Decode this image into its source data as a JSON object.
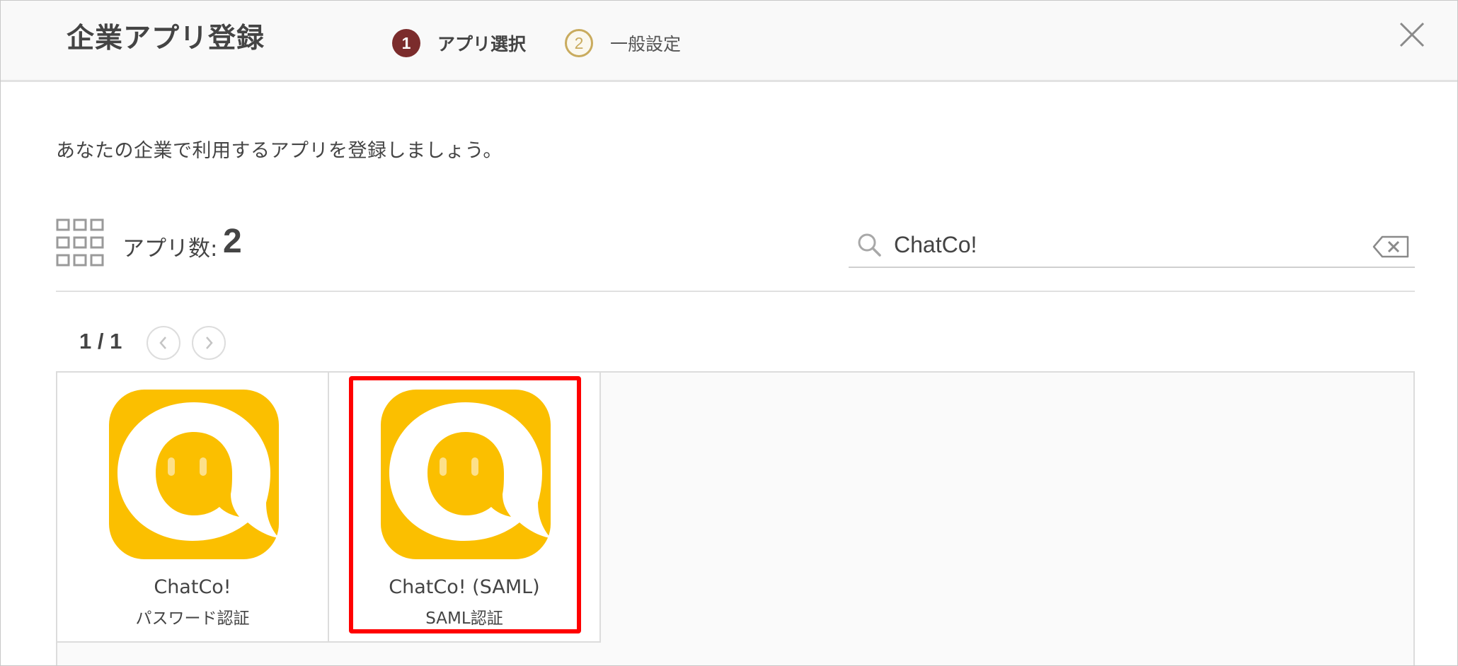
{
  "header": {
    "title": "企業アプリ登録",
    "steps": [
      {
        "number": "1",
        "label": "アプリ選択",
        "state": "active"
      },
      {
        "number": "2",
        "label": "一般設定",
        "state": "upcoming"
      }
    ],
    "close_icon": "close-icon"
  },
  "description": "あなたの企業で利用するアプリを登録しましょう。",
  "app_count": {
    "label": "アプリ数:",
    "value": "2",
    "icon": "grid-icon"
  },
  "search": {
    "value": "ChatCo!",
    "icon": "search-icon",
    "clear_icon": "clear-input-icon"
  },
  "pagination": {
    "indicator": "1 / 1",
    "prev_icon": "chevron-left-icon",
    "next_icon": "chevron-right-icon"
  },
  "apps": [
    {
      "name": "ChatCo!",
      "auth": "パスワード認証",
      "icon": "chatco-logo-icon"
    },
    {
      "name": "ChatCo! (SAML)",
      "auth": "SAML認証",
      "icon": "chatco-logo-icon",
      "highlighted": true
    }
  ],
  "colors": {
    "step_active": "#7b2c2c",
    "step_upcoming": "#c9ab5e",
    "app_logo": "#fbbf00",
    "highlight": "#ff0000"
  }
}
